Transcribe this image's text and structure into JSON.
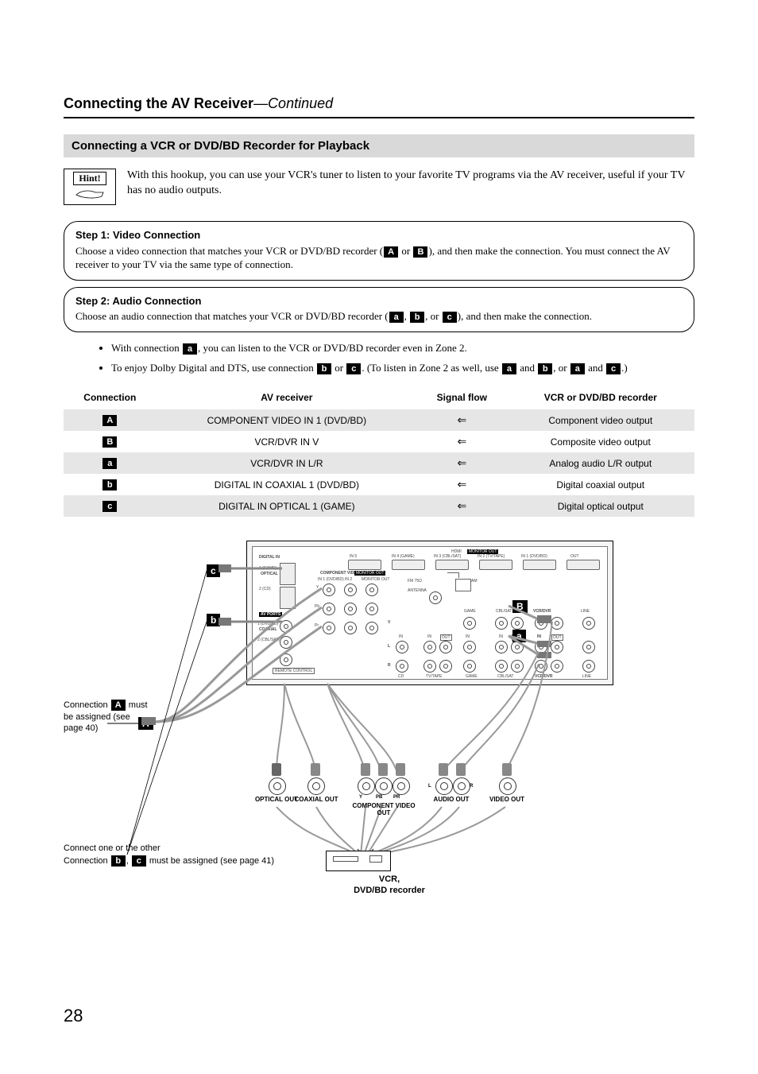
{
  "running_head": {
    "title": "Connecting the AV Receiver",
    "continued": "—Continued"
  },
  "section_title": "Connecting a VCR or DVD/BD Recorder for Playback",
  "hint": {
    "label": "Hint!",
    "text": "With this hookup, you can use your VCR's tuner to listen to your favorite TV programs via the AV receiver, useful if your TV has no audio outputs."
  },
  "step1": {
    "title": "Step 1: Video Connection",
    "body_pre": "Choose a video connection that matches your VCR or DVD/BD recorder (",
    "body_mid": " or ",
    "body_post": "), and then make the connection. You must connect the AV receiver to your TV via the same type of connection."
  },
  "step2": {
    "title": "Step 2: Audio Connection",
    "body_pre": "Choose an audio connection that matches your VCR or DVD/BD recorder (",
    "sep1": ", ",
    "sep2": ", or ",
    "body_post": "), and then make the connection."
  },
  "badges": {
    "A": "A",
    "B": "B",
    "a": "a",
    "b": "b",
    "c": "c"
  },
  "bullets": {
    "b1_pre": "With connection ",
    "b1_post": ", you can listen to the VCR or DVD/BD recorder even in Zone 2.",
    "b2_pre": "To enjoy Dolby Digital and DTS, use connection ",
    "b2_mid1": " or ",
    "b2_mid2": ". (To listen in Zone 2 as well, use ",
    "b2_and": " and ",
    "b2_or": ", or ",
    "b2_post": ".)"
  },
  "table": {
    "headers": [
      "Connection",
      "AV receiver",
      "Signal flow",
      "VCR or DVD/BD recorder"
    ],
    "rows": [
      {
        "badge": "A",
        "receiver": "COMPONENT VIDEO IN 1 (DVD/BD)",
        "flow": "⇐",
        "device": "Component video output",
        "shade": true
      },
      {
        "badge": "B",
        "receiver": "VCR/DVR IN V",
        "flow": "⇐",
        "device": "Composite video output",
        "shade": false
      },
      {
        "badge": "a",
        "receiver": "VCR/DVR IN L/R",
        "flow": "⇐",
        "device": "Analog audio L/R output",
        "shade": true
      },
      {
        "badge": "b",
        "receiver": "DIGITAL IN COAXIAL 1 (DVD/BD)",
        "flow": "⇐",
        "device": "Digital coaxial output",
        "shade": false
      },
      {
        "badge": "c",
        "receiver": "DIGITAL IN OPTICAL 1 (GAME)",
        "flow": "⇐",
        "device": "Digital optical output",
        "shade": true
      }
    ]
  },
  "figure": {
    "side_note_pre": "Connection ",
    "side_note_post": " must be assigned (see page 40)",
    "bottom_note_line1": "Connect one or the other",
    "bottom_note_pre": "Connection ",
    "bottom_note_sep": ", ",
    "bottom_note_post": " must be assigned (see page 41)",
    "recorder_label_l1": "VCR,",
    "recorder_label_l2": "DVD/BD recorder",
    "plugs": {
      "optical": "OPTICAL OUT",
      "coaxial": "COAXIAL OUT",
      "component": "COMPONENT VIDEO OUT",
      "y": "Y",
      "pb": "PB",
      "pr": "PR",
      "audio": "AUDIO OUT",
      "l": "L",
      "r": "R",
      "video": "VIDEO OUT"
    },
    "panel": {
      "digital_in": "DIGITAL IN",
      "optical": "OPTICAL",
      "coaxial": "COAXIAL",
      "opt1": "1 (GAME)",
      "opt2": "2 (CD)",
      "coax1": "1 (DVD/BD)",
      "coax2": "2 (CBL/SAT)",
      "av_ports": "AV PORTS",
      "remote": "REMOTE CONTROL",
      "component": "COMPONENT VIDEO",
      "comp_in1": "IN 1 (DVD/BD)",
      "comp_in2": "IN 2",
      "comp_out": "MONITOR OUT",
      "hdmi": "HDMI",
      "hdmi_out": "OUT",
      "hdmi_in1": "IN 1 (DVD/BD)",
      "hdmi_in2": "IN 2 (TV/TAPE)",
      "hdmi_in3": "IN 3 (CBL/SAT)",
      "hdmi_in4": "IN 4 (GAME)",
      "hdmi_in5": "IN 5",
      "monitor_out_box": "MONITOR OUT",
      "antenna": "ANTENNA",
      "fm": "FM 75Ω",
      "am": "AM",
      "rows": {
        "v": "V",
        "l": "L",
        "r": "R"
      },
      "groups": {
        "cd": "CD",
        "tvtape": "TV/TAPE",
        "game": "GAME",
        "cblsat": "CBL/SAT",
        "vcrdvr": "VCR/DVR",
        "line": "LINE"
      },
      "in": "IN",
      "out": "OUT"
    }
  },
  "page_number": "28"
}
